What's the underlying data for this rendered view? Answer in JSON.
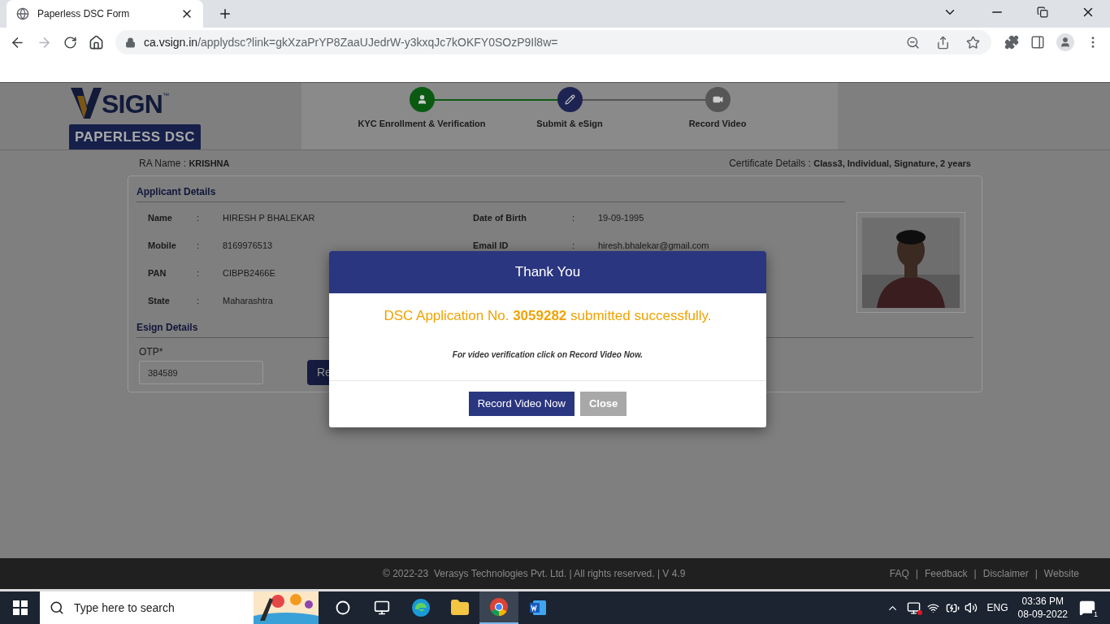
{
  "browser": {
    "tab": {
      "title": "Paperless DSC Form",
      "selected": true
    },
    "address": {
      "host": "ca.vsign.in",
      "path": "/applydsc?link=gkXzaPrYP8ZaaUJedrW-y3kxqJc7kOKFY0SOzP9Il8w="
    }
  },
  "header": {
    "logo": {
      "text": "SIGN",
      "trademark": "™",
      "badge": "PAPERLESS DSC"
    },
    "steps": [
      {
        "label": "KYC Enrollment & Verification",
        "completed": true,
        "selected": false
      },
      {
        "label": "Submit & eSign",
        "completed": false,
        "selected": true
      },
      {
        "label": "Record Video",
        "completed": false,
        "selected": false
      }
    ]
  },
  "ra": {
    "label": "RA Name :",
    "value": "KRISHNA"
  },
  "certificate": {
    "label": "Certificate Details :",
    "value": "Class3, Individual, Signature, 2 years"
  },
  "applicant": {
    "title": "Applicant Details",
    "left": [
      {
        "label": "Name",
        "colon": ":",
        "value": "HIRESH P BHALEKAR"
      },
      {
        "label": "Mobile",
        "colon": ":",
        "value": "8169976513"
      },
      {
        "label": "PAN",
        "colon": ":",
        "value": "CIBPB2466E"
      },
      {
        "label": "State",
        "colon": ":",
        "value": "Maharashtra"
      }
    ],
    "right": [
      {
        "label": "Date of Birth",
        "colon": ":",
        "value": "19-09-1995"
      },
      {
        "label": "Email ID",
        "colon": ":",
        "value": "hiresh.bhalekar@gmail.com"
      }
    ]
  },
  "esign": {
    "title": "Esign Details",
    "otp_label": "OTP*",
    "otp_value": "384589",
    "button": "Re"
  },
  "modal": {
    "title": "Thank You",
    "message": "DSC Application No. **3059282** submitted successfully.",
    "note": "For video verification click on Record Video Now.",
    "buttons": [
      {
        "label": "Record Video Now",
        "kind": "primary"
      },
      {
        "label": "Close",
        "kind": "secondary"
      }
    ]
  },
  "footer": {
    "copyright": "© 2022-23  Verasys Technologies Pvt. Ltd. | All rights reserved. | V 4.9",
    "links": [
      "FAQ",
      "Feedback",
      "Disclaimer",
      "Website"
    ],
    "separator": "|"
  },
  "taskbar": {
    "search_placeholder": "Type here to search",
    "apps": [
      {
        "kind": "cortana",
        "selected": false
      },
      {
        "kind": "taskview",
        "selected": false
      },
      {
        "kind": "edge",
        "selected": false
      },
      {
        "kind": "explorer",
        "selected": false
      },
      {
        "kind": "chrome",
        "selected": true
      },
      {
        "kind": "word",
        "selected": false
      }
    ],
    "language": "ENG",
    "time": "03:36 PM",
    "date": "08-09-2022",
    "notifications": "1"
  }
}
